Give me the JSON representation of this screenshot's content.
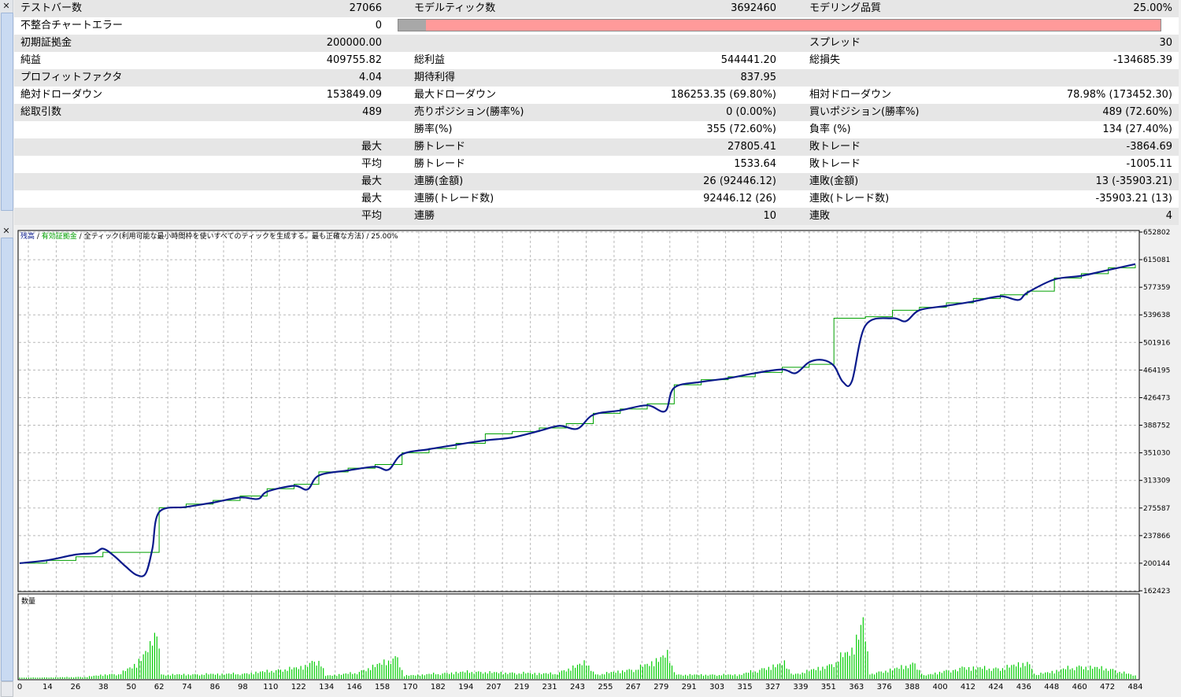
{
  "report": {
    "rows": [
      {
        "c1": "テストバー数",
        "c2": "27066",
        "c3": "モデルティック数",
        "c4": "3692460",
        "c5": "モデリング品質",
        "c6": "25.00%"
      },
      {
        "c1": "不整合チャートエラー",
        "c2": "0",
        "c3": "",
        "c4": "",
        "c5": "",
        "c6": ""
      },
      {
        "c1": "初期証拠金",
        "c2": "200000.00",
        "c3": "",
        "c4": "",
        "c5": "スプレッド",
        "c6": "30"
      },
      {
        "c1": "純益",
        "c2": "409755.82",
        "c3": "総利益",
        "c4": "544441.20",
        "c5": "総損失",
        "c6": "-134685.39"
      },
      {
        "c1": "プロフィットファクタ",
        "c2": "4.04",
        "c3": "期待利得",
        "c4": "837.95",
        "c5": "",
        "c6": ""
      },
      {
        "c1": "絶対ドローダウン",
        "c2": "153849.09",
        "c3": "最大ドローダウン",
        "c4": "186253.35 (69.80%)",
        "c5": "相対ドローダウン",
        "c6": "78.98% (173452.30)"
      },
      {
        "c1": "総取引数",
        "c2": "489",
        "c3": "売りポジション(勝率%)",
        "c4": "0 (0.00%)",
        "c5": "買いポジション(勝率%)",
        "c6": "489 (72.60%)"
      },
      {
        "c1": "",
        "c2": "",
        "c3": "勝率(%)",
        "c4": "355 (72.60%)",
        "c5": "負率 (%)",
        "c6": "134 (27.40%)"
      },
      {
        "c1": "",
        "c2": "最大",
        "c3": "勝トレード",
        "c4": "27805.41",
        "c5": "敗トレード",
        "c6": "-3864.69"
      },
      {
        "c1": "",
        "c2": "平均",
        "c3": "勝トレード",
        "c4": "1533.64",
        "c5": "敗トレード",
        "c6": "-1005.11"
      },
      {
        "c1": "",
        "c2": "最大",
        "c3": "連勝(金額)",
        "c4": "26 (92446.12)",
        "c5": "連敗(金額)",
        "c6": "13 (-35903.21)"
      },
      {
        "c1": "",
        "c2": "最大",
        "c3": "連勝(トレード数)",
        "c4": "92446.12 (26)",
        "c5": "連敗(トレード数)",
        "c6": "-35903.21 (13)"
      },
      {
        "c1": "",
        "c2": "平均",
        "c3": "連勝",
        "c4": "10",
        "c5": "連敗",
        "c6": "4"
      }
    ],
    "modeling_quality_fill": 0.036,
    "colors": {
      "row_alt": "#e6e6e6",
      "bar_track": "#ff9a9a",
      "bar_fill": "#a8a8a8"
    }
  },
  "chart": {
    "legend": {
      "balance": "残高",
      "sep1": " / ",
      "equity": "有効証拠金",
      "sep2": " / ",
      "mode": "全ティック(利用可能な最小時間枠を使いすべてのティックを生成する。最も正確な方法)",
      "sep3": " / ",
      "quality": "25.00%"
    },
    "volume_label": "数量"
  },
  "chart_data": {
    "type": "line",
    "title": "",
    "xlabel": "",
    "ylabel": "",
    "xlim": [
      0,
      496
    ],
    "ylim": [
      162423,
      652802
    ],
    "grid": true,
    "x_ticks": [
      0,
      14,
      26,
      38,
      50,
      62,
      74,
      86,
      98,
      110,
      122,
      134,
      146,
      158,
      170,
      182,
      194,
      207,
      219,
      231,
      243,
      255,
      267,
      279,
      291,
      303,
      315,
      327,
      339,
      351,
      363,
      376,
      388,
      400,
      412,
      424,
      436,
      448,
      460,
      472,
      484
    ],
    "y_ticks": [
      652802,
      615081,
      577359,
      539638,
      501916,
      464195,
      426473,
      388752,
      351030,
      313309,
      275587,
      237866,
      200144,
      162423
    ],
    "series": [
      {
        "name": "残高",
        "color": "#00a000",
        "x": [
          0,
          12,
          25,
          37,
          62,
          74,
          86,
          98,
          110,
          122,
          133,
          146,
          158,
          170,
          182,
          194,
          207,
          219,
          231,
          243,
          255,
          267,
          279,
          291,
          303,
          315,
          327,
          339,
          351,
          362,
          376,
          388,
          400,
          412,
          424,
          436,
          448,
          460,
          472,
          484,
          496
        ],
        "values": [
          200200,
          204000,
          209000,
          215000,
          276000,
          281000,
          286000,
          292000,
          302000,
          308000,
          325000,
          330000,
          335000,
          351000,
          357000,
          364000,
          377000,
          380000,
          385000,
          391000,
          405000,
          411000,
          418000,
          444000,
          451000,
          455000,
          461000,
          468000,
          472000,
          535000,
          537000,
          546000,
          550000,
          556000,
          562000,
          567000,
          572000,
          590000,
          596000,
          604000,
          608000
        ]
      },
      {
        "name": "有効証拠金",
        "color": "#0a1a8c",
        "x": [
          0,
          12,
          25,
          33,
          37,
          42,
          47,
          52,
          56,
          59,
          62,
          74,
          86,
          98,
          106,
          110,
          122,
          128,
          133,
          146,
          158,
          164,
          170,
          182,
          194,
          207,
          219,
          231,
          240,
          248,
          255,
          267,
          279,
          287,
          291,
          303,
          315,
          327,
          339,
          345,
          351,
          357,
          362,
          366,
          370,
          376,
          388,
          394,
          400,
          412,
          424,
          436,
          444,
          448,
          460,
          472,
          484,
          496
        ],
        "values": [
          200200,
          204000,
          212000,
          214000,
          220000,
          210000,
          196000,
          184000,
          186000,
          220000,
          270000,
          277000,
          283000,
          290000,
          288000,
          298000,
          306000,
          301000,
          320000,
          327000,
          332000,
          328000,
          349000,
          356000,
          362000,
          368000,
          372000,
          381000,
          388000,
          384000,
          403000,
          409000,
          416000,
          408000,
          440000,
          448000,
          453000,
          460000,
          465000,
          460000,
          475000,
          478000,
          470000,
          448000,
          449000,
          525000,
          535000,
          531000,
          546000,
          552000,
          558000,
          565000,
          560000,
          570000,
          588000,
          593000,
          601000,
          609000
        ]
      }
    ],
    "volume": {
      "name": "数量",
      "color": "#00cc00",
      "profile": [
        [
          0,
          2
        ],
        [
          30,
          4
        ],
        [
          37,
          8
        ],
        [
          45,
          10
        ],
        [
          52,
          30
        ],
        [
          58,
          60
        ],
        [
          61,
          110
        ],
        [
          63,
          8
        ],
        [
          100,
          10
        ],
        [
          125,
          22
        ],
        [
          133,
          38
        ],
        [
          136,
          6
        ],
        [
          150,
          12
        ],
        [
          168,
          42
        ],
        [
          171,
          6
        ],
        [
          200,
          14
        ],
        [
          214,
          12
        ],
        [
          238,
          10
        ],
        [
          252,
          32
        ],
        [
          256,
          8
        ],
        [
          275,
          20
        ],
        [
          288,
          46
        ],
        [
          292,
          8
        ],
        [
          320,
          8
        ],
        [
          340,
          30
        ],
        [
          344,
          8
        ],
        [
          360,
          26
        ],
        [
          370,
          56
        ],
        [
          375,
          110
        ],
        [
          378,
          10
        ],
        [
          388,
          18
        ],
        [
          398,
          30
        ],
        [
          402,
          6
        ],
        [
          418,
          22
        ],
        [
          436,
          20
        ],
        [
          448,
          32
        ],
        [
          452,
          8
        ],
        [
          470,
          24
        ],
        [
          484,
          20
        ],
        [
          496,
          6
        ]
      ]
    }
  }
}
